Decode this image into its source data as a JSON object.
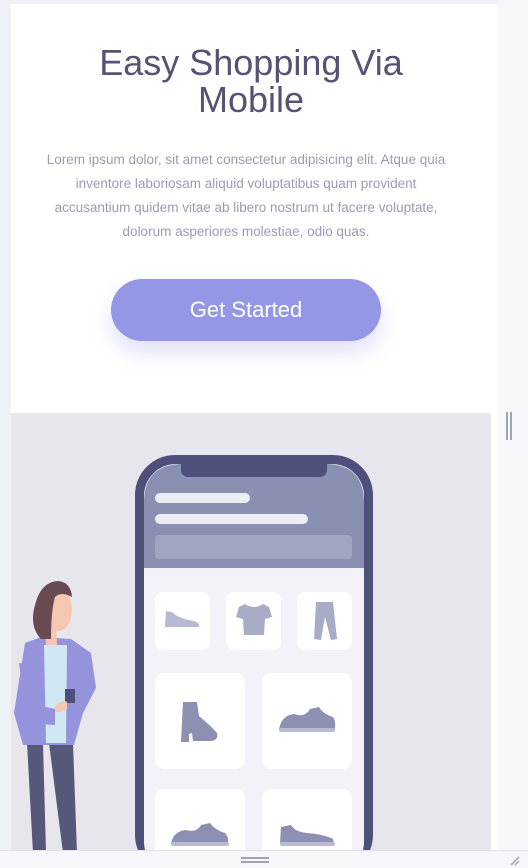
{
  "hero": {
    "title": "Easy Shopping Via Mobile",
    "description": "Lorem ipsum dolor, sit amet consectetur adipisicing elit. Atque quia inventore laboriosam aliquid voluptatibus quam provident accusantium quidem vitae ab libero nostrum ut facere voluptate, dolorum asperiores molestiae, odio quas.",
    "cta_label": "Get Started"
  },
  "illustration": {
    "subject": "phone-shopping-app-with-woman",
    "products": [
      "shoe-icon",
      "tshirt-icon",
      "pants-icon",
      "boot-icon",
      "sneaker-icon",
      "sneaker-icon",
      "sneaker-icon"
    ]
  },
  "colors": {
    "accent": "#9397e6",
    "title": "#535474",
    "text": "#9a9cb1",
    "phone_frame": "#4f4f7b",
    "illustration_bg": "#e8e6ed"
  }
}
